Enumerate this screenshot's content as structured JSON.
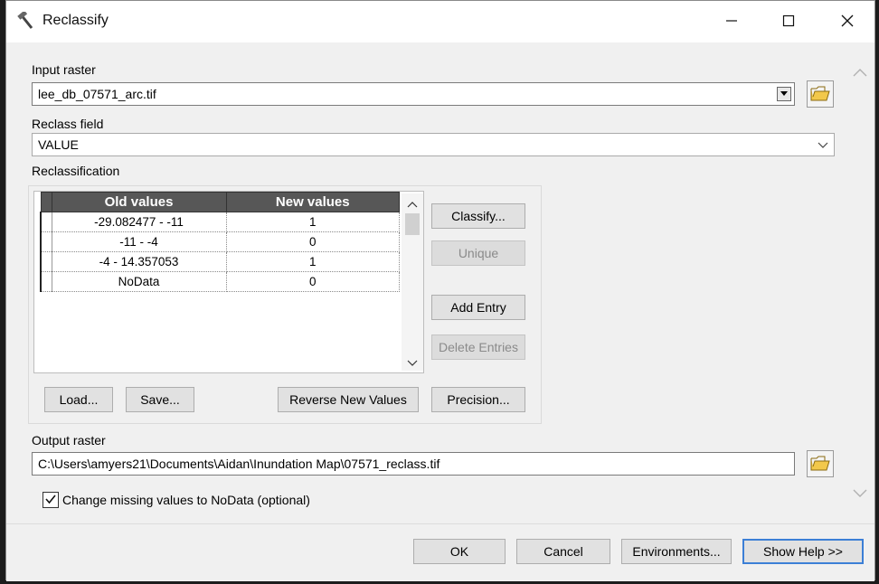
{
  "window": {
    "title": "Reclassify",
    "icon": "hammer-icon"
  },
  "controls": {
    "minimize_icon": "minimize-icon",
    "maximize_icon": "maximize-icon",
    "close_icon": "close-icon"
  },
  "input_raster": {
    "label": "Input raster",
    "value": "lee_db_07571_arc.tif"
  },
  "reclass_field": {
    "label": "Reclass field",
    "value": "VALUE"
  },
  "reclassification": {
    "label": "Reclassification",
    "columns": [
      "Old values",
      "New values"
    ],
    "rows": [
      {
        "old": "-29.082477 - -11",
        "new": "1"
      },
      {
        "old": "-11 - -4",
        "new": "0"
      },
      {
        "old": "-4 - 14.357053",
        "new": "1"
      },
      {
        "old": "NoData",
        "new": "0"
      }
    ],
    "buttons": {
      "classify": "Classify...",
      "unique": "Unique",
      "add_entry": "Add Entry",
      "delete_entries": "Delete Entries",
      "load": "Load...",
      "save": "Save...",
      "reverse": "Reverse New Values",
      "precision": "Precision..."
    }
  },
  "output_raster": {
    "label": "Output raster",
    "value": "C:\\Users\\amyers21\\Documents\\Aidan\\Inundation Map\\07571_reclass.tif"
  },
  "missing_values": {
    "label": "Change missing values to NoData (optional)",
    "checked": true
  },
  "footer": {
    "ok": "OK",
    "cancel": "Cancel",
    "environments": "Environments...",
    "show_help": "Show Help >>"
  }
}
